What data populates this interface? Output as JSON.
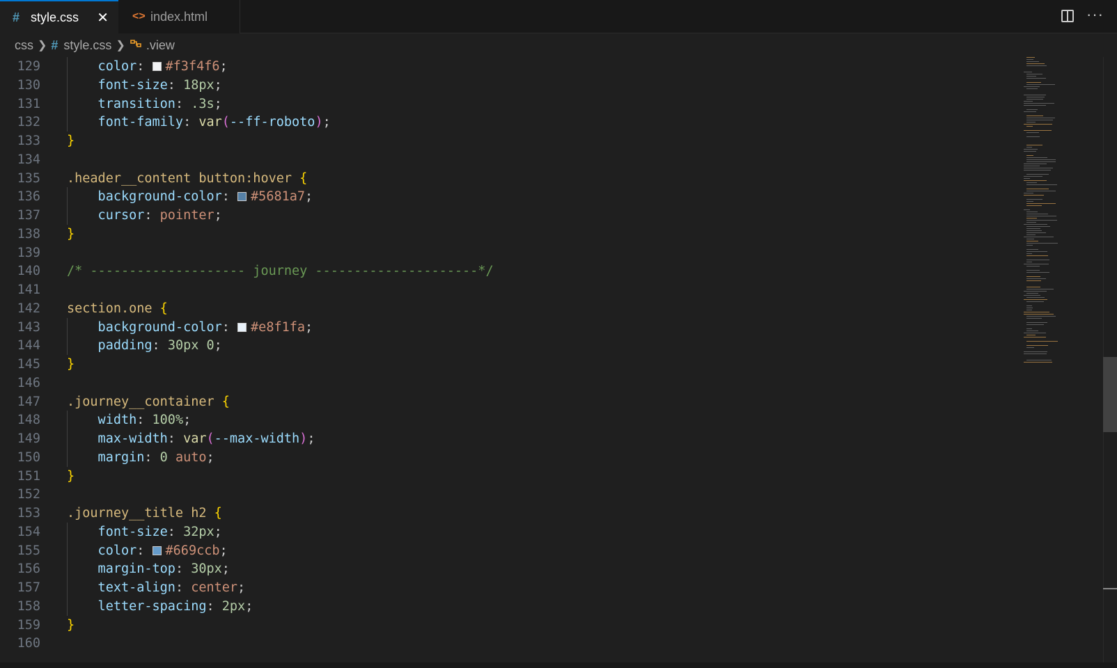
{
  "tabs": [
    {
      "icon": "#",
      "label": "style.css",
      "active": true,
      "close": "✕"
    },
    {
      "icon": "<>",
      "label": "index.html",
      "active": false
    }
  ],
  "breadcrumb": {
    "folder": "css",
    "file_icon": "#",
    "file": "style.css",
    "symbol_icon": "symbol-class-icon",
    "symbol": ".view"
  },
  "editor": {
    "lines": [
      {
        "n": "129",
        "parts": [
          [
            "prop",
            "    color"
          ],
          [
            "punc",
            ": "
          ],
          [
            "swatch",
            "#f3f4f6"
          ],
          [
            "str",
            "#f3f4f6"
          ],
          [
            "punc",
            ";"
          ]
        ]
      },
      {
        "n": "130",
        "parts": [
          [
            "prop",
            "    font-size"
          ],
          [
            "punc",
            ": "
          ],
          [
            "num",
            "18px"
          ],
          [
            "punc",
            ";"
          ]
        ]
      },
      {
        "n": "131",
        "parts": [
          [
            "prop",
            "    transition"
          ],
          [
            "punc",
            ": "
          ],
          [
            "num",
            ".3s"
          ],
          [
            "punc",
            ";"
          ]
        ]
      },
      {
        "n": "132",
        "parts": [
          [
            "prop",
            "    font-family"
          ],
          [
            "punc",
            ": "
          ],
          [
            "fn",
            "var"
          ],
          [
            "paren",
            "("
          ],
          [
            "var",
            "--ff-roboto"
          ],
          [
            "paren",
            ")"
          ],
          [
            "punc",
            ";"
          ]
        ]
      },
      {
        "n": "133",
        "parts": [
          [
            "brace",
            "}"
          ]
        ]
      },
      {
        "n": "134",
        "parts": []
      },
      {
        "n": "135",
        "parts": [
          [
            "sel",
            ".header__content button:hover "
          ],
          [
            "brace",
            "{"
          ]
        ]
      },
      {
        "n": "136",
        "parts": [
          [
            "prop",
            "    background-color"
          ],
          [
            "punc",
            ": "
          ],
          [
            "swatch",
            "#5681a7"
          ],
          [
            "str",
            "#5681a7"
          ],
          [
            "punc",
            ";"
          ]
        ]
      },
      {
        "n": "137",
        "parts": [
          [
            "prop",
            "    cursor"
          ],
          [
            "punc",
            ": "
          ],
          [
            "str",
            "pointer"
          ],
          [
            "punc",
            ";"
          ]
        ]
      },
      {
        "n": "138",
        "parts": [
          [
            "brace",
            "}"
          ]
        ]
      },
      {
        "n": "139",
        "parts": []
      },
      {
        "n": "140",
        "parts": [
          [
            "comment",
            "/* -------------------- journey ---------------------*/"
          ]
        ]
      },
      {
        "n": "141",
        "parts": []
      },
      {
        "n": "142",
        "parts": [
          [
            "sel",
            "section.one "
          ],
          [
            "brace",
            "{"
          ]
        ]
      },
      {
        "n": "143",
        "parts": [
          [
            "prop",
            "    background-color"
          ],
          [
            "punc",
            ": "
          ],
          [
            "swatch",
            "#e8f1fa"
          ],
          [
            "str",
            "#e8f1fa"
          ],
          [
            "punc",
            ";"
          ]
        ]
      },
      {
        "n": "144",
        "parts": [
          [
            "prop",
            "    padding"
          ],
          [
            "punc",
            ": "
          ],
          [
            "num",
            "30px 0"
          ],
          [
            "punc",
            ";"
          ]
        ]
      },
      {
        "n": "145",
        "parts": [
          [
            "brace",
            "}"
          ]
        ]
      },
      {
        "n": "146",
        "parts": []
      },
      {
        "n": "147",
        "parts": [
          [
            "sel",
            ".journey__container "
          ],
          [
            "brace",
            "{"
          ]
        ]
      },
      {
        "n": "148",
        "parts": [
          [
            "prop",
            "    width"
          ],
          [
            "punc",
            ": "
          ],
          [
            "num",
            "100%"
          ],
          [
            "punc",
            ";"
          ]
        ]
      },
      {
        "n": "149",
        "parts": [
          [
            "prop",
            "    max-width"
          ],
          [
            "punc",
            ": "
          ],
          [
            "fn",
            "var"
          ],
          [
            "paren",
            "("
          ],
          [
            "var",
            "--max-width"
          ],
          [
            "paren",
            ")"
          ],
          [
            "punc",
            ";"
          ]
        ]
      },
      {
        "n": "150",
        "parts": [
          [
            "prop",
            "    margin"
          ],
          [
            "punc",
            ": "
          ],
          [
            "num",
            "0 "
          ],
          [
            "str",
            "auto"
          ],
          [
            "punc",
            ";"
          ]
        ]
      },
      {
        "n": "151",
        "parts": [
          [
            "brace",
            "}"
          ]
        ]
      },
      {
        "n": "152",
        "parts": []
      },
      {
        "n": "153",
        "parts": [
          [
            "sel",
            ".journey__title h2 "
          ],
          [
            "brace",
            "{"
          ]
        ]
      },
      {
        "n": "154",
        "parts": [
          [
            "prop",
            "    font-size"
          ],
          [
            "punc",
            ": "
          ],
          [
            "num",
            "32px"
          ],
          [
            "punc",
            ";"
          ]
        ]
      },
      {
        "n": "155",
        "parts": [
          [
            "prop",
            "    color"
          ],
          [
            "punc",
            ": "
          ],
          [
            "swatch",
            "#669ccb"
          ],
          [
            "str",
            "#669ccb"
          ],
          [
            "punc",
            ";"
          ]
        ]
      },
      {
        "n": "156",
        "parts": [
          [
            "prop",
            "    margin-top"
          ],
          [
            "punc",
            ": "
          ],
          [
            "num",
            "30px"
          ],
          [
            "punc",
            ";"
          ]
        ]
      },
      {
        "n": "157",
        "parts": [
          [
            "prop",
            "    text-align"
          ],
          [
            "punc",
            ": "
          ],
          [
            "str",
            "center"
          ],
          [
            "punc",
            ";"
          ]
        ]
      },
      {
        "n": "158",
        "parts": [
          [
            "prop",
            "    letter-spacing"
          ],
          [
            "punc",
            ": "
          ],
          [
            "num",
            "2px"
          ],
          [
            "punc",
            ";"
          ]
        ]
      },
      {
        "n": "159",
        "parts": [
          [
            "brace",
            "}"
          ]
        ]
      },
      {
        "n": "160",
        "parts": []
      }
    ]
  },
  "colors": {
    "accent": "#0078d4",
    "editor_bg": "#1f1f1f"
  }
}
